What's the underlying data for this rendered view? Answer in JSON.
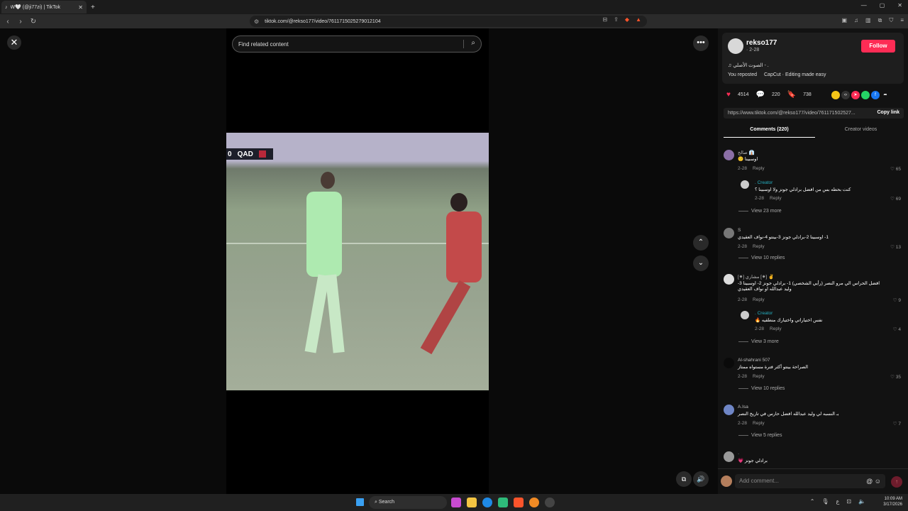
{
  "browser": {
    "tab_title": "W🤍 (@ji77zi) | TikTok",
    "new_tab": "+",
    "url": "tiktok.com/@rekso177/video/7611715025279012104"
  },
  "page": {
    "search_placeholder": "Find related content"
  },
  "video": {
    "scoreboard_prefix": "0",
    "team": "QAD"
  },
  "creator": {
    "username": "rekso177",
    "date": "· 2-28",
    "follow_label": "Follow",
    "sound": "♫ الصوت الأصلي - .",
    "reposted": "You reposted",
    "capcut": "CapCut · Editing made easy"
  },
  "stats": {
    "likes": "4514",
    "comments": "220",
    "saves": "738"
  },
  "share": {
    "link": "https://www.tiktok.com/@rekso177/video/761171502527...",
    "copy_label": "Copy link"
  },
  "tabs": {
    "comments": "Comments (220)",
    "creator_videos": "Creator videos"
  },
  "comments": [
    {
      "name": "صالح 👔",
      "text": "اوسبينا 🙂",
      "date": "2-28",
      "reply": "Reply",
      "likes": "65"
    },
    {
      "name": ". Creator",
      "text": "كنت بحطه بس من افضل برادلي جونز ولا اوسبينا ؟",
      "date": "2-28",
      "reply": "Reply",
      "likes": "69"
    },
    {
      "name": "S",
      "text": "1- اوسبينا 2-برادلي جونز 3-بينتو 4-نواف العقيدي",
      "date": "2-28",
      "reply": "Reply",
      "likes": "13"
    },
    {
      "name": "[✷] مشاري [✷] ✌",
      "text": "افضل الحراس الي مرو النصر (رأيي الشخصي) 1- برادلي جونز 2- اوسبينا 3- وليد عبدالله او نواف العقيدي",
      "date": "2-28",
      "reply": "Reply",
      "likes": "9"
    },
    {
      "name": ". Creator",
      "text": "نفس اختياراتي واختيارك منطقيه 🔥",
      "date": "2-28",
      "reply": "Reply",
      "likes": "4"
    },
    {
      "name": "Al-shahrani 507",
      "text": "الصراحة بينتو أكثر فترة مستواه ممتاز",
      "date": "2-28",
      "reply": "Reply",
      "likes": "35"
    },
    {
      "name": "A.Isa",
      "text": "بـ النسبه لي وليد عبدالله افضل حارس في تاريخ النصر",
      "date": "2-28",
      "reply": "Reply",
      "likes": "7"
    },
    {
      "name": "·",
      "text": "برادلي جونز 💗",
      "date": "",
      "reply": "",
      "likes": ""
    }
  ],
  "view_more": [
    "View 23 more",
    "View 10 replies",
    "View 3 more",
    "View 10 replies",
    "View 5 replies"
  ],
  "add_comment_placeholder": "Add comment...",
  "taskbar": {
    "search": "Search",
    "time": "10:09 AM",
    "date": "3/17/2026"
  }
}
